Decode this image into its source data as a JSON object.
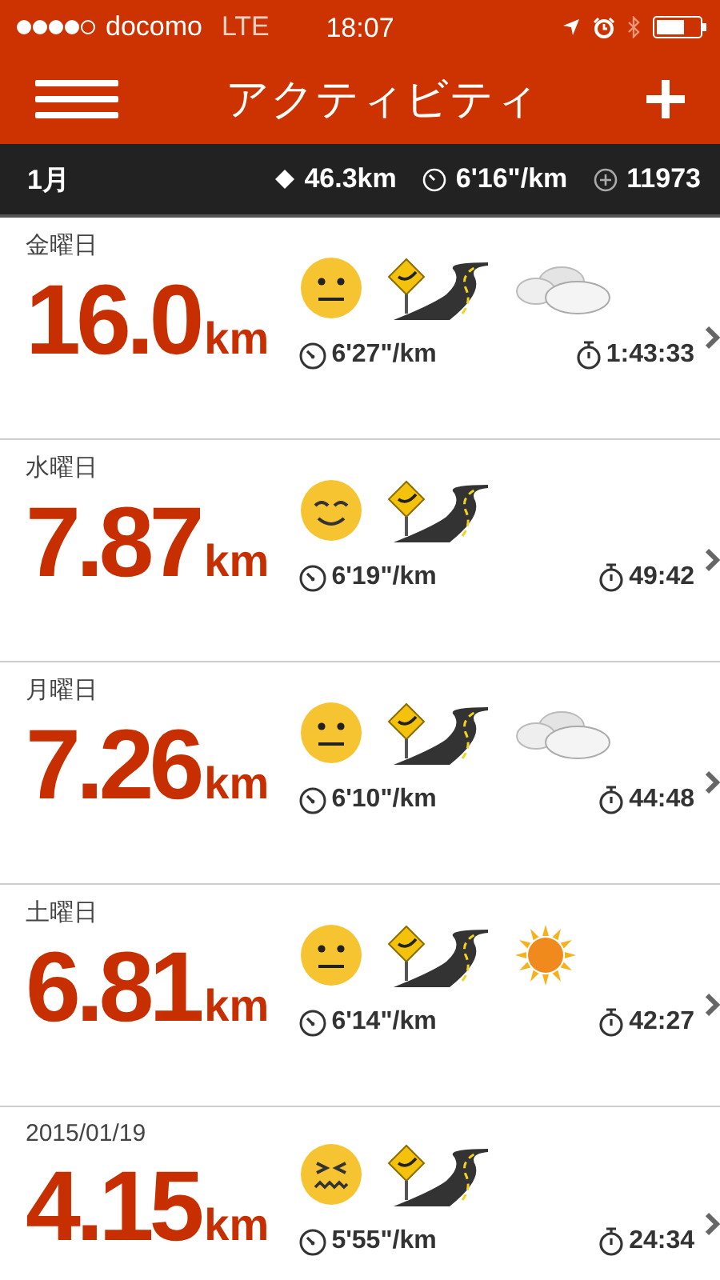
{
  "status_bar": {
    "carrier": "docomo",
    "network": "LTE",
    "time": "18:07"
  },
  "nav": {
    "title": "アクティビティ"
  },
  "summary": {
    "month": "1月",
    "distance": "46.3km",
    "pace": "6'16\"/km",
    "calories": "11973"
  },
  "activities": [
    {
      "date": "金曜日",
      "distance": "16.0",
      "unit": "km",
      "mood": {
        "kind": "neutral"
      },
      "weather": {
        "kind": "cloudy"
      },
      "pace": "6'27\"/km",
      "duration": "1:43:33"
    },
    {
      "date": "水曜日",
      "distance": "7.87",
      "unit": "km",
      "mood": {
        "kind": "smile"
      },
      "pace": "6'19\"/km",
      "duration": "49:42"
    },
    {
      "date": "月曜日",
      "distance": "7.26",
      "unit": "km",
      "mood": {
        "kind": "neutral"
      },
      "weather": {
        "kind": "cloudy"
      },
      "pace": "6'10\"/km",
      "duration": "44:48"
    },
    {
      "date": "土曜日",
      "distance": "6.81",
      "unit": "km",
      "mood": {
        "kind": "neutral"
      },
      "weather": {
        "kind": "sunny"
      },
      "pace": "6'14\"/km",
      "duration": "42:27"
    },
    {
      "date": "2015/01/19",
      "distance": "4.15",
      "unit": "km",
      "mood": {
        "kind": "tired"
      },
      "pace": "5'55\"/km",
      "duration": "24:34"
    }
  ]
}
